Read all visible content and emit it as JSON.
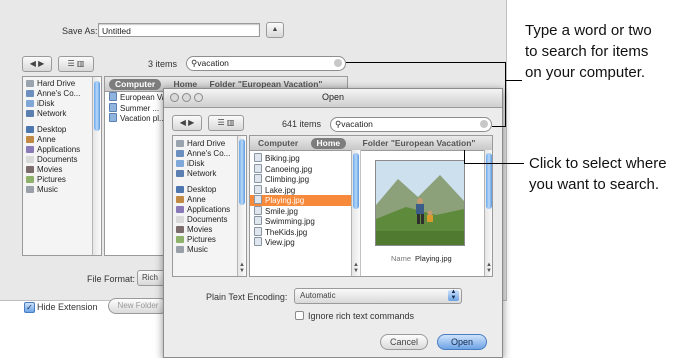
{
  "save_dialog": {
    "save_as_label": "Save As:",
    "save_as_value": "Untitled",
    "item_count": "3 items",
    "search_value": "vacation",
    "path_tabs": [
      "Computer",
      "Home",
      "Folder \"European Vacation\""
    ],
    "sidebar_items": [
      {
        "label": "Hard Drive",
        "icon": "hard-drive-icon"
      },
      {
        "label": "Anne's Co...",
        "icon": "computer-icon"
      },
      {
        "label": "iDisk",
        "icon": "idisk-icon"
      },
      {
        "label": "Network",
        "icon": "network-icon"
      },
      {
        "label": "Desktop",
        "icon": "desktop-icon"
      },
      {
        "label": "Anne",
        "icon": "home-icon"
      },
      {
        "label": "Applications",
        "icon": "applications-icon"
      },
      {
        "label": "Documents",
        "icon": "documents-icon"
      },
      {
        "label": "Movies",
        "icon": "movies-icon"
      },
      {
        "label": "Pictures",
        "icon": "pictures-icon"
      },
      {
        "label": "Music",
        "icon": "music-icon"
      }
    ],
    "results": [
      "European Vacation",
      "Summer ...",
      "Vacation pl..."
    ],
    "file_format_label": "File Format:",
    "file_format_value": "Rich",
    "hide_extension_label": "Hide Extension",
    "new_folder_label": "New Folder"
  },
  "open_dialog": {
    "title": "Open",
    "item_count": "641 items",
    "search_value": "vacation",
    "path_tabs": [
      "Computer",
      "Home",
      "Folder \"European Vacation\""
    ],
    "selected_tab": "Home",
    "sidebar_items": [
      {
        "label": "Hard Drive",
        "icon": "hard-drive-icon"
      },
      {
        "label": "Anne's Co...",
        "icon": "computer-icon"
      },
      {
        "label": "iDisk",
        "icon": "idisk-icon"
      },
      {
        "label": "Network",
        "icon": "network-icon"
      },
      {
        "label": "Desktop",
        "icon": "desktop-icon"
      },
      {
        "label": "Anne",
        "icon": "home-icon"
      },
      {
        "label": "Applications",
        "icon": "applications-icon"
      },
      {
        "label": "Documents",
        "icon": "documents-icon"
      },
      {
        "label": "Movies",
        "icon": "movies-icon"
      },
      {
        "label": "Pictures",
        "icon": "pictures-icon"
      },
      {
        "label": "Music",
        "icon": "music-icon"
      }
    ],
    "files": [
      {
        "name": "Biking.jpg",
        "selected": false
      },
      {
        "name": "Canoeing.jpg",
        "selected": false
      },
      {
        "name": "Climbing.jpg",
        "selected": false
      },
      {
        "name": "Lake.jpg",
        "selected": false
      },
      {
        "name": "Playing.jpg",
        "selected": true
      },
      {
        "name": "Smile.jpg",
        "selected": false
      },
      {
        "name": "Swimming.jpg",
        "selected": false
      },
      {
        "name": "TheKids.jpg",
        "selected": false
      },
      {
        "name": "View.jpg",
        "selected": false
      }
    ],
    "preview_name_label": "Name",
    "preview_name_value": "Playing.jpg",
    "encoding_label": "Plain Text Encoding:",
    "encoding_value": "Automatic",
    "ignore_rich_label": "Ignore rich text commands",
    "cancel_label": "Cancel",
    "open_label": "Open"
  },
  "callouts": {
    "search": [
      "Type a word or two",
      "to search for items",
      "on your computer."
    ],
    "location": [
      "Click to select where",
      "you want to search."
    ]
  },
  "colors": {
    "selection": "#f7893a",
    "accent_blue": "#6da3e5",
    "dialog_gray": "#ececec"
  }
}
